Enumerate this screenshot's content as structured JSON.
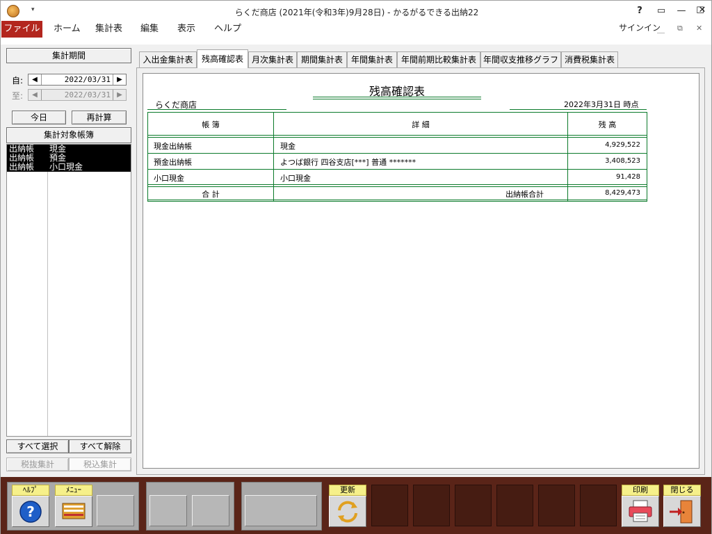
{
  "titlebar": {
    "title": "らくだ商店 (2021年(令和3年)9月28日) - かるがるできる出納22",
    "qa_arrow": "▾",
    "help": "?",
    "ribbon": "▭",
    "minimize": "—",
    "restore": "☐",
    "close": "✕"
  },
  "menubar": {
    "file": "ファイル",
    "items": [
      "ホーム",
      "集計表",
      "編集",
      "表示",
      "ヘルプ"
    ],
    "signin": "サインイン",
    "min_glyph": "＿",
    "restore_glyph": "⧉",
    "close_glyph": "✕"
  },
  "left_panel": {
    "period_header": "集計期間",
    "from_label": "自:",
    "from_date": "2022/03/31",
    "to_label": "至:",
    "to_date": "2022/03/31",
    "today_btn": "今日",
    "recalc_btn": "再計算",
    "ledgers_header": "集計対象帳簿",
    "ledgers": [
      {
        "type": "出納帳",
        "name": "現金"
      },
      {
        "type": "出納帳",
        "name": "預金"
      },
      {
        "type": "出納帳",
        "name": "小口現金"
      }
    ],
    "select_all": "すべて選択",
    "deselect_all": "すべて解除",
    "tax_excluded": "税抜集計",
    "tax_included": "税込集計"
  },
  "tabs": [
    "入出金集計表",
    "残高確認表",
    "月次集計表",
    "期間集計表",
    "年間集計表",
    "年間前期比較集計表",
    "年間収支推移グラフ",
    "消費税集計表"
  ],
  "report": {
    "title": "残高確認表",
    "shop": "らくだ商店",
    "as_of": "2022年3月31日 時点",
    "headers": {
      "book": "帳 簿",
      "detail": "詳 細",
      "balance": "残 高"
    },
    "rows": [
      {
        "book": "現金出納帳",
        "detail": "現金",
        "balance": "4,929,522"
      },
      {
        "book": "預金出納帳",
        "detail": "よつば銀行 四谷支店[***] 普通 *******",
        "balance": "3,408,523"
      },
      {
        "book": "小口現金",
        "detail": "小口現金",
        "balance": "91,428"
      }
    ],
    "total": {
      "label": "合 計",
      "detail": "出納帳合計",
      "balance": "8,429,473"
    }
  },
  "toolbar": {
    "help": "ﾍﾙﾌﾟ",
    "menu": "ﾒﾆｭｰ",
    "refresh": "更新",
    "print": "印刷",
    "close": "閉じる"
  },
  "colors": {
    "accent": "#b3261e",
    "toolbar_bg": "#5a2418",
    "rule_green": "#0a7a2a",
    "label_yellow": "#f6f08a"
  }
}
